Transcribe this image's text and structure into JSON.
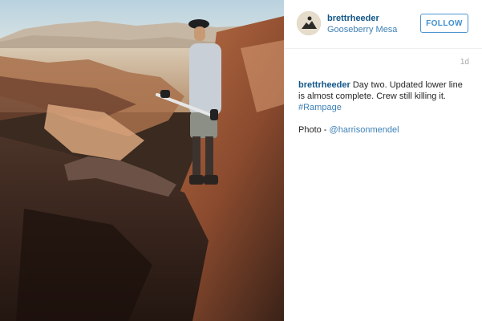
{
  "post": {
    "username": "brettrheeder",
    "location": "Gooseberry Mesa",
    "follow_label": "FOLLOW",
    "timestamp": "1d",
    "caption": {
      "username": "brettrheeder",
      "text": " Day two. Updated lower line is almost complete. Crew still killing it. ",
      "hashtag": "#Rampage",
      "credit_prefix": "Photo - ",
      "credit_handle": "@harrisonmendel"
    }
  },
  "colors": {
    "link": "#125688",
    "follow_border": "#4f96d1",
    "timestamp": "#a5a7aa"
  },
  "icons": {
    "avatar": "avatar-image"
  }
}
